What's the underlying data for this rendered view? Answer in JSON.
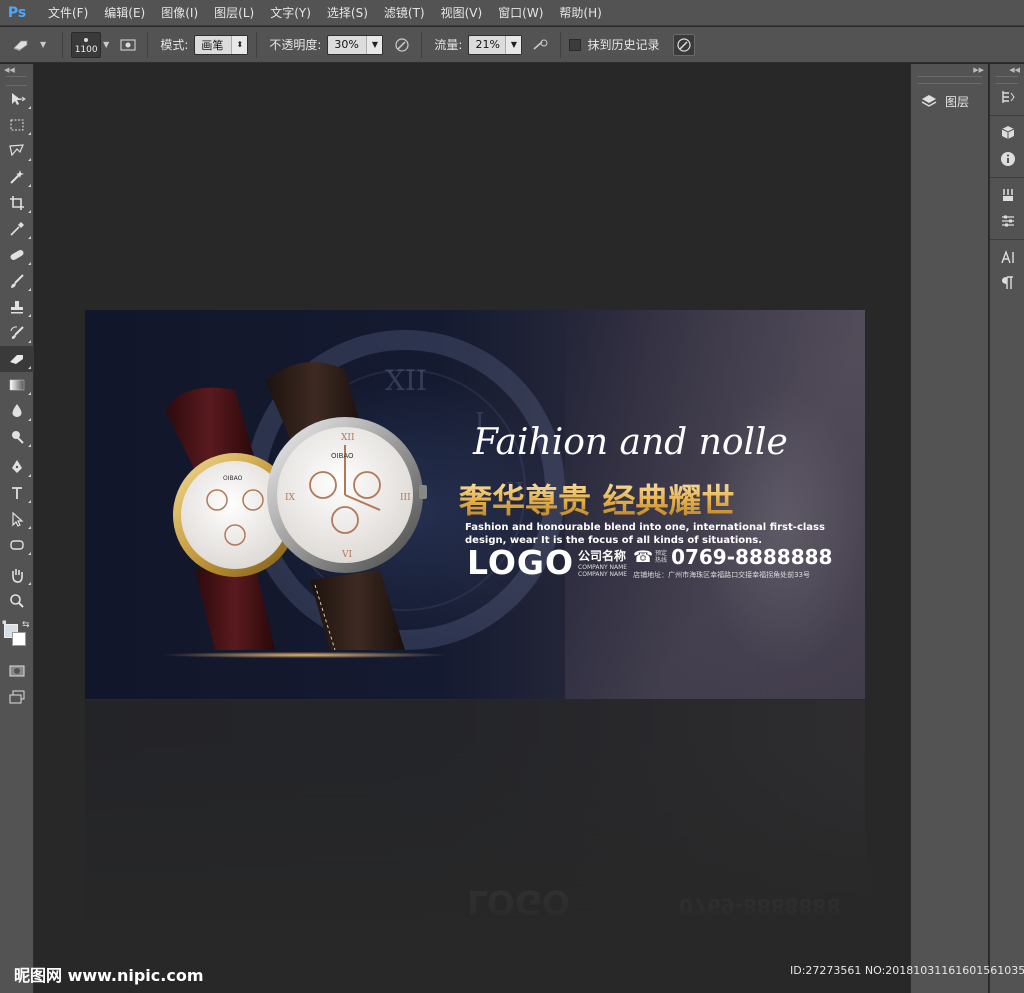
{
  "app": {
    "logo": "Ps"
  },
  "menu": [
    "文件(F)",
    "编辑(E)",
    "图像(I)",
    "图层(L)",
    "文字(Y)",
    "选择(S)",
    "滤镜(T)",
    "视图(V)",
    "窗口(W)",
    "帮助(H)"
  ],
  "options": {
    "brush_size": "1100",
    "mode_label": "模式:",
    "mode_value": "画笔",
    "opacity_label": "不透明度:",
    "opacity_value": "30%",
    "flow_label": "流量:",
    "flow_value": "21%",
    "history_label": "抹到历史记录"
  },
  "panels": {
    "layers_label": "图层"
  },
  "banner": {
    "script_title": "Faihion and nolle",
    "cn_title": "奢华尊贵 经典耀世",
    "en_desc": "Fashion and honourable blend into one, international first-class design, wear It is the focus of all kinds of situations.",
    "logo": "LOGO",
    "company_cn": "公司名称",
    "company_en_1": "COMPANY NAME",
    "company_en_2": "COMPANY NAME",
    "phone_small_1": "预定",
    "phone_small_2": "热线",
    "phone": "0769-8888888",
    "address": "店铺地址：广州市海珠区幸福路口交接幸福拐角处前33号",
    "watch_brand": "OIBAO"
  },
  "watermark": {
    "left": "昵图网 www.nipic.com",
    "right": "ID:27273561 NO:20181031161601561035"
  },
  "colors": {
    "accent_gold": "#e6b04a",
    "ps_blue": "#4aa8ff",
    "chrome": "#535353",
    "canvas_bg": "#282828"
  }
}
